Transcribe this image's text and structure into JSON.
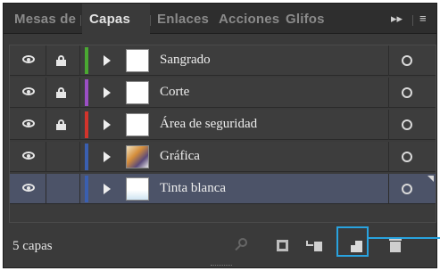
{
  "tabs": [
    {
      "label": "Mesas de",
      "active": false
    },
    {
      "label": "Capas",
      "active": true
    },
    {
      "label": "Enlaces",
      "active": false
    },
    {
      "label": "Acciones",
      "active": false
    },
    {
      "label": "Glifos",
      "active": false
    }
  ],
  "panel_controls": {
    "collapse": "▸▸",
    "menu": "≡"
  },
  "layers": [
    {
      "name": "Sangrado",
      "color": "#4aa832",
      "locked": true,
      "visible": true,
      "thumbnail": "blank",
      "selected": false
    },
    {
      "name": "Corte",
      "color": "#9b4fc4",
      "locked": true,
      "visible": true,
      "thumbnail": "blank",
      "selected": false
    },
    {
      "name": "Área de seguridad",
      "color": "#d2342c",
      "locked": true,
      "visible": true,
      "thumbnail": "blank",
      "selected": false
    },
    {
      "name": "Gráfica",
      "color": "#3a5fb0",
      "locked": false,
      "visible": true,
      "thumbnail": "graphic",
      "selected": false
    },
    {
      "name": "Tinta blanca",
      "color": "#3a5fb0",
      "locked": false,
      "visible": true,
      "thumbnail": "tinta",
      "selected": true
    }
  ],
  "footer": {
    "count_label": "5 capas"
  },
  "icons": {
    "locate": "search-icon",
    "clipping": "make-clipping-mask-icon",
    "sublayer": "new-sublayer-icon",
    "new_layer": "new-layer-icon",
    "delete": "trash-icon"
  },
  "accent_color": "#29a3df"
}
